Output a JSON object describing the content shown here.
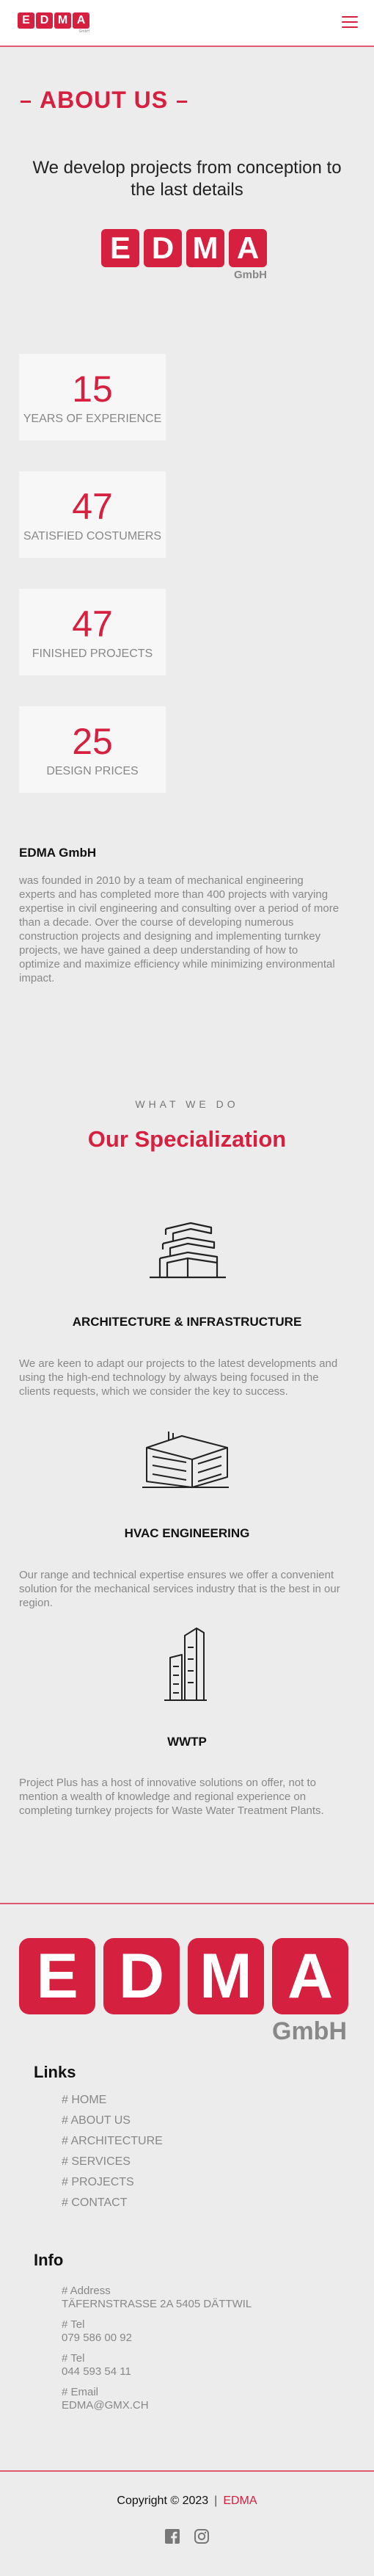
{
  "header": {
    "logo_letters": [
      "E",
      "D",
      "M",
      "A"
    ],
    "logo_suffix": "GmbH",
    "menu_icon": "hamburger-menu-icon"
  },
  "about": {
    "title": "ABOUT US",
    "tagline": "We develop projects from conception to the last details"
  },
  "stats": [
    {
      "number": "15",
      "label": "YEARS OF EXPERIENCE"
    },
    {
      "number": "47",
      "label": "SATISFIED COSTUMERS"
    },
    {
      "number": "47",
      "label": "FINISHED PROJECTS"
    },
    {
      "number": "25",
      "label": "DESIGN PRICES"
    }
  ],
  "company": {
    "name": "EDMA GmbH",
    "description": "was founded in 2010 by a team of mechanical engineering experts and has completed more than 400 projects with varying expertise in civil engineering and consulting over a period of more than a decade. Over the course of developing numerous construction projects and designing and implementing turnkey projects, we have gained a deep understanding of how to optimize and maximize efficiency while minimizing environmental impact."
  },
  "specialization": {
    "eyebrow": "WHAT WE DO",
    "title": "Our Specialization",
    "services": [
      {
        "title": "ARCHITECTURE & INFRASTRUCTURE",
        "icon": "architecture-building-icon",
        "description": "We are keen to adapt our projects to the latest developments and using the high-end technology by always being focused in the clients requests, which we consider the key to success."
      },
      {
        "title": "HVAC ENGINEERING",
        "icon": "hvac-building-icon",
        "description": "Our range and technical expertise ensures we offer a convenient solution for the mechanical services industry that is the best in our region."
      },
      {
        "title": "WWTP",
        "icon": "tower-buildings-icon",
        "description": "Project Plus has a host of innovative solutions on offer, not to mention a wealth of knowledge and regional experience on completing turnkey projects for Waste Water Treatment Plants."
      }
    ]
  },
  "footer": {
    "links_heading": "Links",
    "links": [
      "# HOME",
      "# ABOUT US",
      "# ARCHITECTURE",
      "# SERVICES",
      "# PROJECTS",
      "# CONTACT"
    ],
    "info_heading": "Info",
    "info": [
      {
        "label": "# Address",
        "value": "TÄFERNSTRASSE 2A 5405 DÄTTWIL"
      },
      {
        "label": "# Tel",
        "value": "079 586 00 92"
      },
      {
        "label": "# Tel",
        "value": "044 593 54 11"
      },
      {
        "label": "# Email",
        "value": "EDMA@GMX.CH"
      }
    ],
    "copyright": "Copyright © 2023",
    "copyright_separator": "|",
    "copyright_brand": "EDMA",
    "social_icons": [
      "facebook-icon",
      "instagram-icon"
    ]
  },
  "colors": {
    "accent": "#d62040",
    "background": "#ececec",
    "muted_text": "#888888"
  }
}
